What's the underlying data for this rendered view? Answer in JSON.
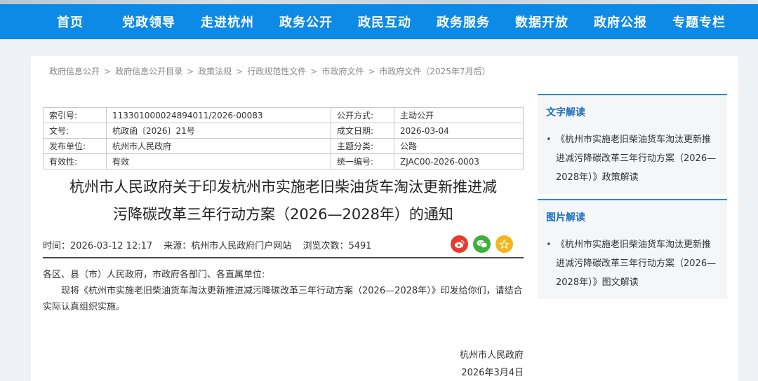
{
  "nav": [
    "首页",
    "党政领导",
    "走进杭州",
    "政务公开",
    "政民互动",
    "政务服务",
    "数据开放",
    "政府公报",
    "专题专栏"
  ],
  "breadcrumb": [
    "政府信息公开",
    "政府信息公开目录",
    "政策法规",
    "行政规范性文件",
    "市政府文件",
    "市政府文件（2025年7月后）"
  ],
  "meta": {
    "index_label": "索引号:",
    "index_value": "113301000024894011/2026-00083",
    "open_label": "公开方式:",
    "open_value": "主动公开",
    "docno_label": "文号:",
    "docno_value": "杭政函〔2026〕21号",
    "date_label": "成文日期:",
    "date_value": "2026-03-04",
    "issuer_label": "发布单位:",
    "issuer_value": "杭州市人民政府",
    "topic_label": "主题分类:",
    "topic_value": "公路",
    "validity_label": "有效性:",
    "validity_value": "有效",
    "code_label": "统一编号:",
    "code_value": "ZJAC00-2026-0003"
  },
  "doc": {
    "title_line1": "杭州市人民政府关于印发杭州市实施老旧柴油货车淘汰更新推进减",
    "title_line2": "污降碳改革三年行动方案（2026—2028年）的通知",
    "time": "时间：2026-03-12 12:17",
    "source": "来源：杭州市人民政府门户网站",
    "views": "浏览次数：5491",
    "salutation": "各区、县（市）人民政府，市政府各部门、各直属单位:",
    "paragraph": "现将《杭州市实施老旧柴油货车淘汰更新推进减污降碳改革三年行动方案（2026—2028年）》印发给你们，请结合实际认真组织实施。",
    "sign_org": "杭州市人民政府",
    "sign_date": "2026年3月4日"
  },
  "share": {
    "weibo_icon": "weibo-icon",
    "wechat_icon": "wechat-icon",
    "favorite_icon": "star-icon",
    "colors": {
      "weibo": "#e53a2f",
      "wechat": "#3fb13a",
      "favorite": "#f3b519"
    }
  },
  "sidebar": {
    "text_title": "文字解读",
    "text_link": "《杭州市实施老旧柴油货车淘汰更新推进减污降碳改革三年行动方案（2026—2028年）》政策解读",
    "image_title": "图片解读",
    "image_link": "《杭州市实施老旧柴油货车淘汰更新推进减污降碳改革三年行动方案（2026—2028年）》图文解读"
  },
  "colors": {
    "nav": "#0d8ae6",
    "accent": "#1f8cdd",
    "side_title": "#1f6fb8"
  }
}
